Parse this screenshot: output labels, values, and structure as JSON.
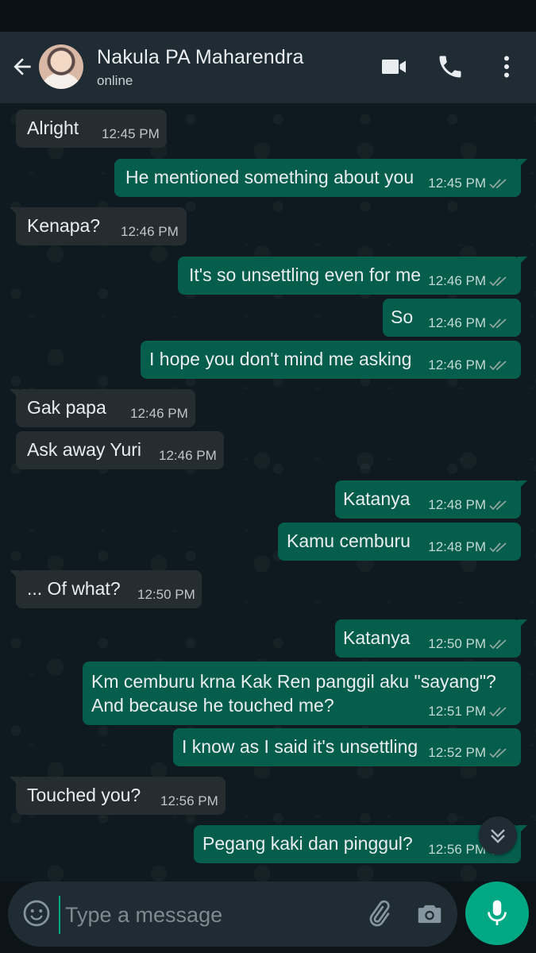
{
  "header": {
    "contact_name": "Nakula PA Maharendra",
    "status": "online",
    "icons": [
      "back-arrow-icon",
      "video-call-icon",
      "phone-call-icon",
      "more-options-icon"
    ]
  },
  "messages": [
    {
      "dir": "in",
      "text": "Alright",
      "time": "12:45 PM"
    },
    {
      "dir": "out",
      "text": "He mentioned something about you",
      "time": "12:45 PM",
      "status": "read"
    },
    {
      "dir": "in",
      "text": "Kenapa?",
      "time": "12:46 PM"
    },
    {
      "dir": "out",
      "text": "It's so unsettling even for me",
      "time": "12:46 PM",
      "status": "read"
    },
    {
      "dir": "out",
      "text": "So",
      "time": "12:46 PM",
      "status": "read"
    },
    {
      "dir": "out",
      "text": "I hope you don't mind me asking",
      "time": "12:46 PM",
      "status": "read"
    },
    {
      "dir": "in",
      "text": "Gak papa",
      "time": "12:46 PM"
    },
    {
      "dir": "in",
      "text": "Ask away Yuri",
      "time": "12:46 PM"
    },
    {
      "dir": "out",
      "text": "Katanya",
      "time": "12:48 PM",
      "status": "read"
    },
    {
      "dir": "out",
      "text": "Kamu cemburu",
      "time": "12:48 PM",
      "status": "read"
    },
    {
      "dir": "in",
      "text": "... Of what?",
      "time": "12:50 PM"
    },
    {
      "dir": "out",
      "text": "Katanya",
      "time": "12:50 PM",
      "status": "read"
    },
    {
      "dir": "out",
      "text": "Km cemburu krna Kak Ren panggil aku \"sayang\"? And because he touched me?",
      "time": "12:51 PM",
      "status": "read"
    },
    {
      "dir": "out",
      "text": "I know as I said it's unsettling",
      "time": "12:52 PM",
      "status": "read"
    },
    {
      "dir": "in",
      "text": "Touched you?",
      "time": "12:56 PM"
    },
    {
      "dir": "out",
      "text": "Pegang kaki dan pinggul?",
      "time": "12:56 PM",
      "status": "read"
    }
  ],
  "composer": {
    "placeholder": "Type a message",
    "icons": [
      "emoji-icon",
      "attach-icon",
      "camera-icon",
      "mic-icon"
    ]
  },
  "colors": {
    "header_bg": "#1f2c33",
    "incoming_bubble": "#262d31",
    "outgoing_bubble": "#055d4c",
    "accent": "#00a884"
  }
}
